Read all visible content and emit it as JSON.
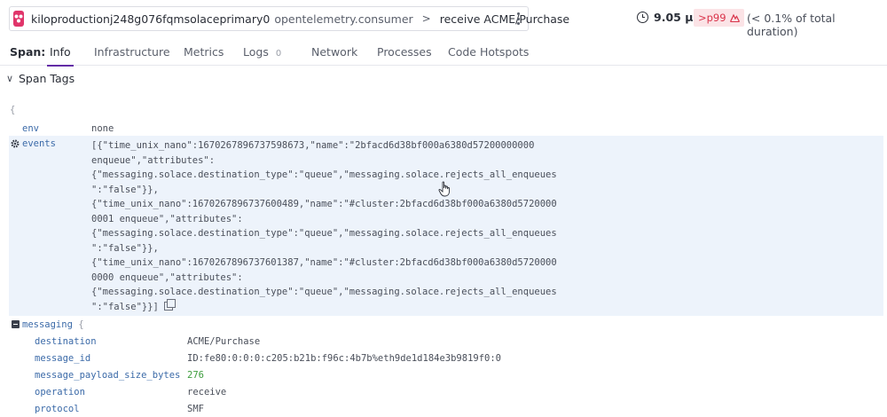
{
  "header": {
    "service_name": "kiloproductionj248g076fqmsolaceprimary0",
    "operation_name": "opentelemetry.consumer",
    "resource_name": "receive ACME/Purchase",
    "duration": "9.05 µs",
    "percentile_badge": ">p99",
    "duration_share": "(< 0.1% of total duration)"
  },
  "tabs": {
    "label": "Span:",
    "items": [
      {
        "label": "Info",
        "active": true
      },
      {
        "label": "Infrastructure"
      },
      {
        "label": "Metrics"
      },
      {
        "label": "Logs",
        "badge": "0"
      },
      {
        "label": "Network"
      },
      {
        "label": "Processes"
      },
      {
        "label": "Code Hotspots"
      }
    ]
  },
  "section": {
    "title": "Span Tags",
    "open_brace": "{"
  },
  "tags": {
    "env": {
      "key": "env",
      "value": "none"
    },
    "events": {
      "key": "events",
      "lines": [
        "[{\"time_unix_nano\":1670267896737598673,\"name\":\"2bfacd6d38bf000a6380d57200000000",
        "enqueue\",\"attributes\":",
        "{\"messaging.solace.destination_type\":\"queue\",\"messaging.solace.rejects_all_enqueues",
        "\":\"false\"}},",
        "{\"time_unix_nano\":1670267896737600489,\"name\":\"#cluster:2bfacd6d38bf000a6380d5720000",
        "0001 enqueue\",\"attributes\":",
        "{\"messaging.solace.destination_type\":\"queue\",\"messaging.solace.rejects_all_enqueues",
        "\":\"false\"}},",
        "{\"time_unix_nano\":1670267896737601387,\"name\":\"#cluster:2bfacd6d38bf000a6380d5720000",
        "0000 enqueue\",\"attributes\":",
        "{\"messaging.solace.destination_type\":\"queue\",\"messaging.solace.rejects_all_enqueues",
        "\":\"false\"}}]"
      ]
    },
    "messaging": {
      "key": "messaging",
      "open_brace": "{",
      "children": [
        {
          "key": "destination",
          "value": "ACME/Purchase"
        },
        {
          "key": "message_id",
          "value": "ID:fe80:0:0:0:c205:b21b:f96c:4b7b%eth9de1d184e3b9819f0:0"
        },
        {
          "key": "message_payload_size_bytes",
          "value": "276"
        },
        {
          "key": "operation",
          "value": "receive"
        },
        {
          "key": "protocol",
          "value": "SMF"
        }
      ]
    }
  },
  "colors": {
    "accent": "#632ca6",
    "service_icon": "#e0356a",
    "key": "#3b6aa8",
    "number": "#3e9d3e",
    "highlight": "#edf3fb",
    "p99_text": "#d9334a"
  }
}
